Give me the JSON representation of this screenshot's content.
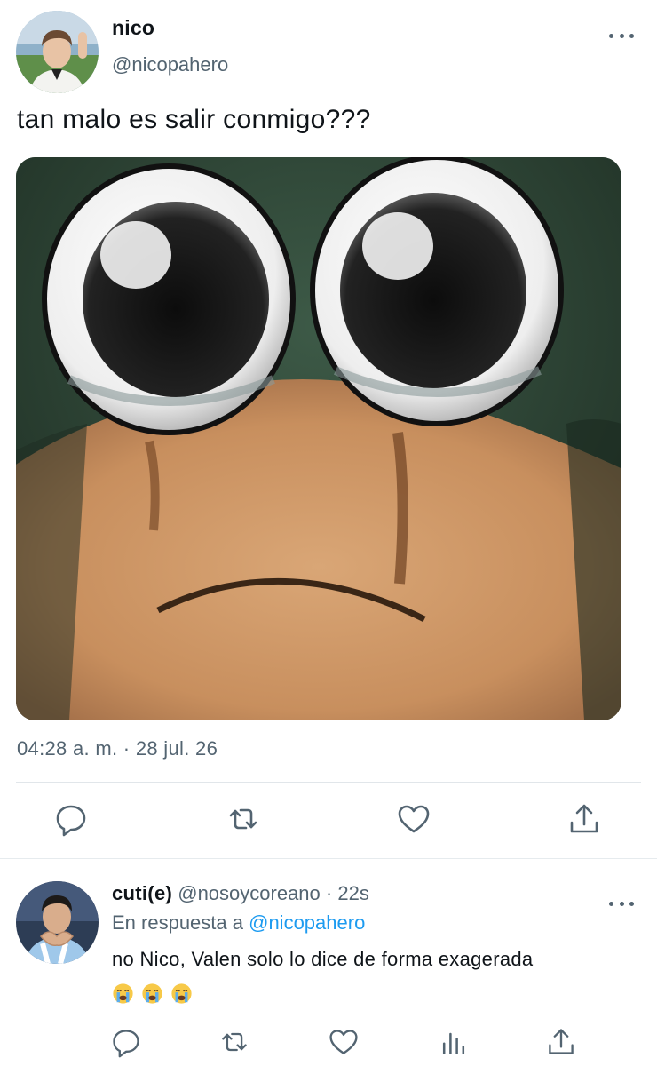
{
  "tweet": {
    "author_name": "nico",
    "author_handle": "@nicopahero",
    "text": "tan malo es salir conmigo???",
    "timestamp": "04:28 a. m. · 28 jul. 26",
    "media_icon": "crying-cartoon-face-image",
    "actions": [
      "reply-icon",
      "retweet-icon",
      "like-icon",
      "share-icon"
    ]
  },
  "reply": {
    "author_name": "cuti(e)",
    "author_handle": "@nosoycoreano",
    "separator": "·",
    "time": "22s",
    "in_reply_prefix": "En respuesta a ",
    "in_reply_mention": "@nicopahero",
    "text": "no Nico, Valen solo lo dice de forma exagerada",
    "emojis": [
      "loudly-crying-face",
      "loudly-crying-face",
      "loudly-crying-face"
    ],
    "actions": [
      "reply-icon",
      "retweet-icon",
      "like-icon",
      "views-icon",
      "share-icon"
    ]
  },
  "colors": {
    "text": "#0f1419",
    "secondary": "#536471",
    "link": "#1d9bf0",
    "divider": "#e1e6ea"
  }
}
